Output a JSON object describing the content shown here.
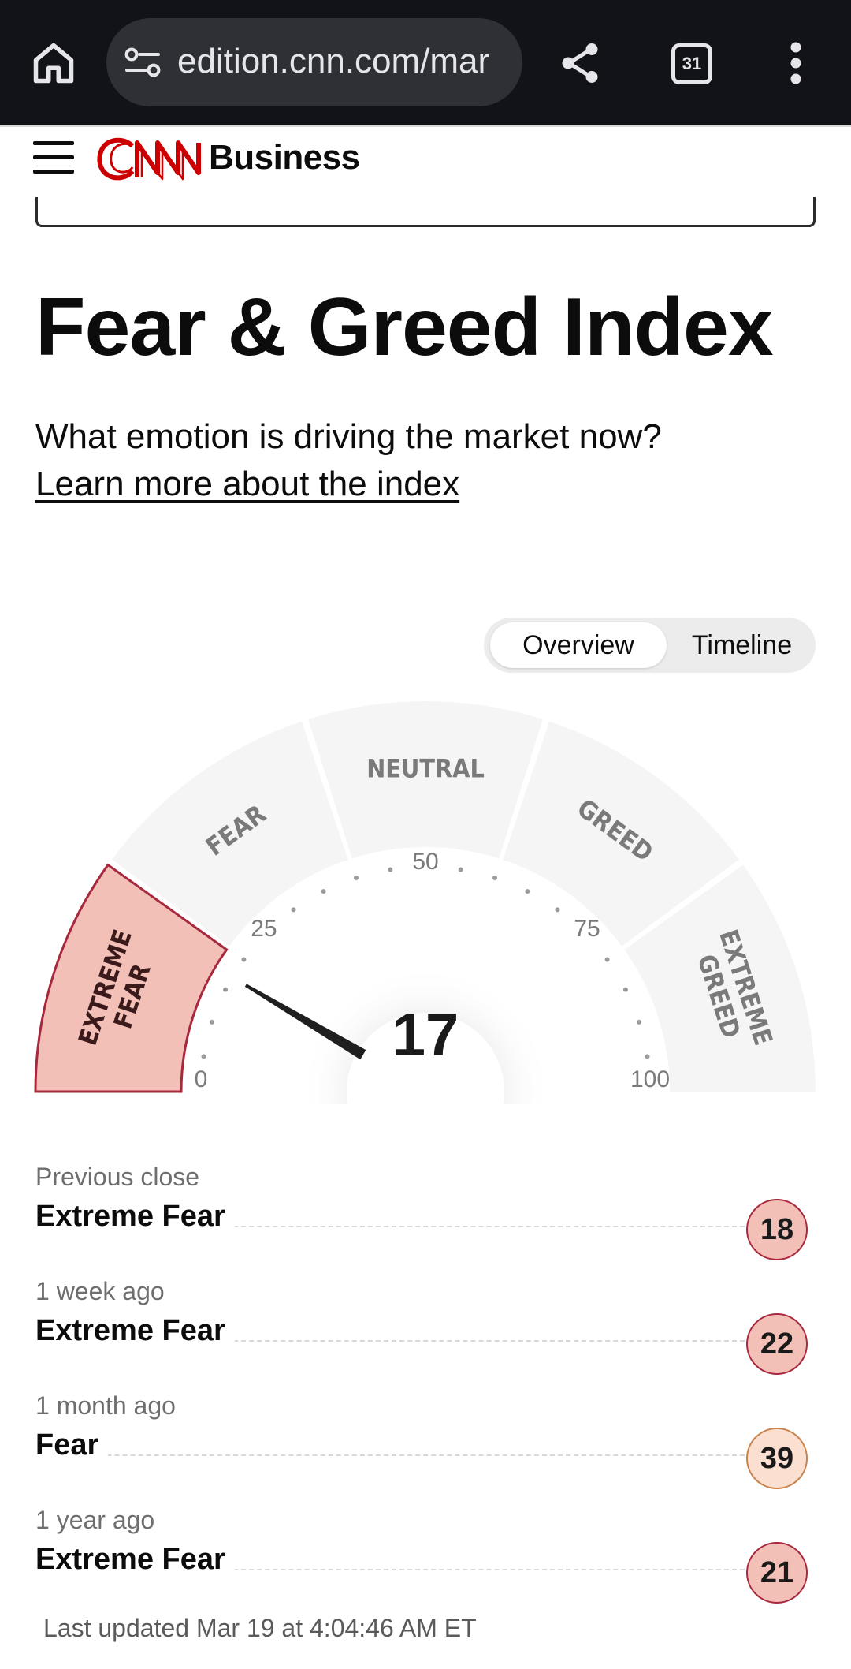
{
  "browser": {
    "url": "edition.cnn.com/mar",
    "tab_count": "31"
  },
  "header": {
    "logo_text": "CNN",
    "section": "Business"
  },
  "page": {
    "title": "Fear & Greed Index",
    "subtitle": "What emotion is driving the market now?",
    "learn_link": "Learn more about the index"
  },
  "toggle": {
    "overview": "Overview",
    "timeline": "Timeline",
    "selected": "Overview"
  },
  "gauge": {
    "value": 17,
    "value_label": "17",
    "range": [
      0,
      100
    ],
    "ticks": [
      "0",
      "25",
      "50",
      "75",
      "100"
    ],
    "segments": [
      "EXTREME FEAR",
      "FEAR",
      "NEUTRAL",
      "GREED",
      "EXTREME GREED"
    ],
    "active_segment": "EXTREME FEAR",
    "colors": {
      "active_fill": "#f3c0b8",
      "active_stroke": "#a8283d",
      "inactive_fill": "#f5f5f5",
      "segment_text": "#7a7a7a",
      "needle": "#1f1f1f"
    }
  },
  "history": [
    {
      "when": "Previous close",
      "rating": "Extreme Fear",
      "value": "18",
      "level": "extreme-fear"
    },
    {
      "when": "1 week ago",
      "rating": "Extreme Fear",
      "value": "22",
      "level": "extreme-fear"
    },
    {
      "when": "1 month ago",
      "rating": "Fear",
      "value": "39",
      "level": "fear"
    },
    {
      "when": "1 year ago",
      "rating": "Extreme Fear",
      "value": "21",
      "level": "extreme-fear"
    }
  ],
  "last_updated": "Last updated Mar 19 at 4:04:46 AM ET"
}
